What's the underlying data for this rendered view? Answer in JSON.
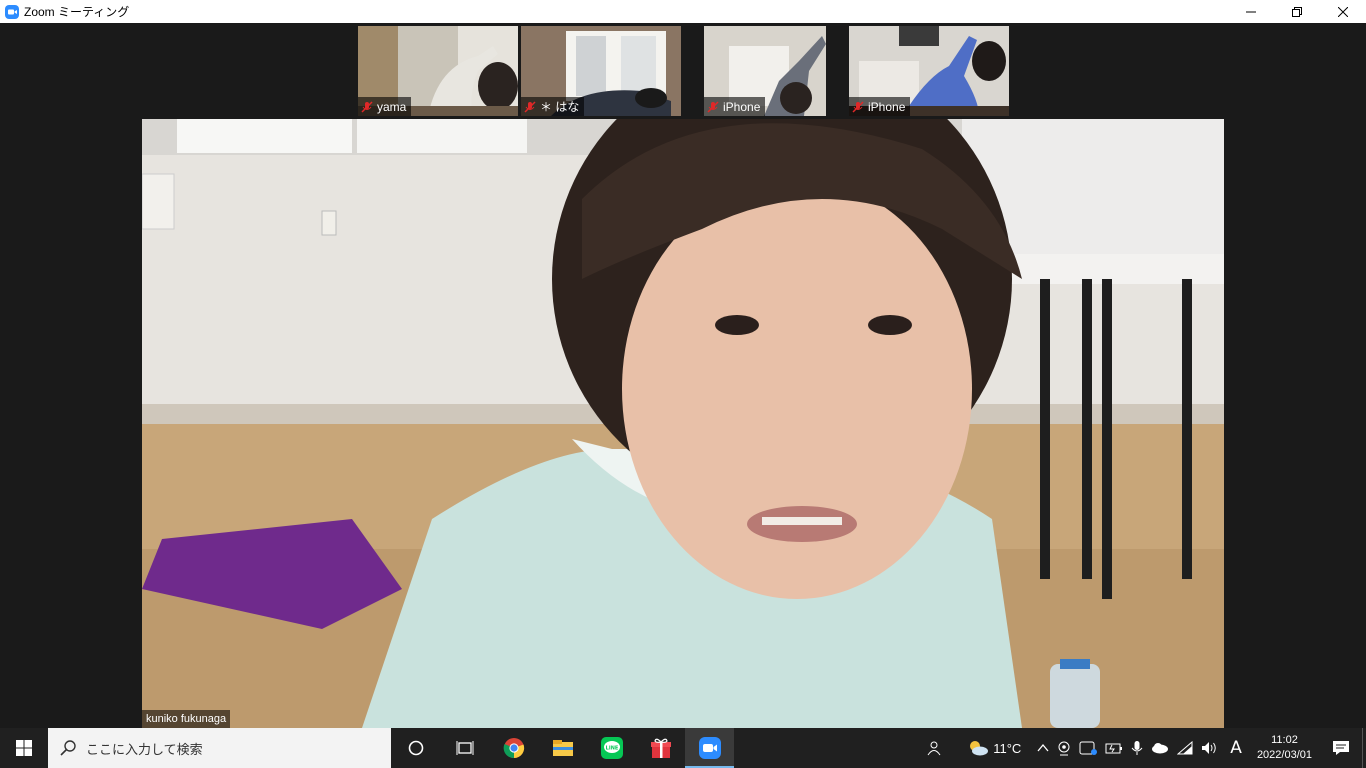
{
  "window": {
    "title": "Zoom ミーティング",
    "app_icon": "zoom-icon",
    "controls": [
      "minimize-icon",
      "restore-icon",
      "close-icon"
    ]
  },
  "participants": [
    {
      "name": "yama",
      "muted": true
    },
    {
      "name": "＊ はな",
      "muted": true
    },
    {
      "name": "iPhone",
      "muted": true
    },
    {
      "name": "iPhone",
      "muted": true
    }
  ],
  "active_speaker": {
    "name": "kuniko fukunaga"
  },
  "taskbar": {
    "search_placeholder": "ここに入力して検索",
    "pinned": [
      {
        "name": "cortana-icon",
        "active": false
      },
      {
        "name": "task-view-icon",
        "active": false
      },
      {
        "name": "chrome-icon",
        "active": false
      },
      {
        "name": "file-explorer-icon",
        "active": false
      },
      {
        "name": "line-icon",
        "active": false
      },
      {
        "name": "gift-icon",
        "active": false
      },
      {
        "name": "zoom-icon",
        "active": true
      }
    ],
    "tray": {
      "weather": "11°C",
      "ime": "A",
      "time": "11:02",
      "date": "2022/03/01"
    }
  },
  "colors": {
    "zoom_blue": "#2d8cff",
    "mute_red": "#e02828",
    "taskbar": "#202020"
  }
}
